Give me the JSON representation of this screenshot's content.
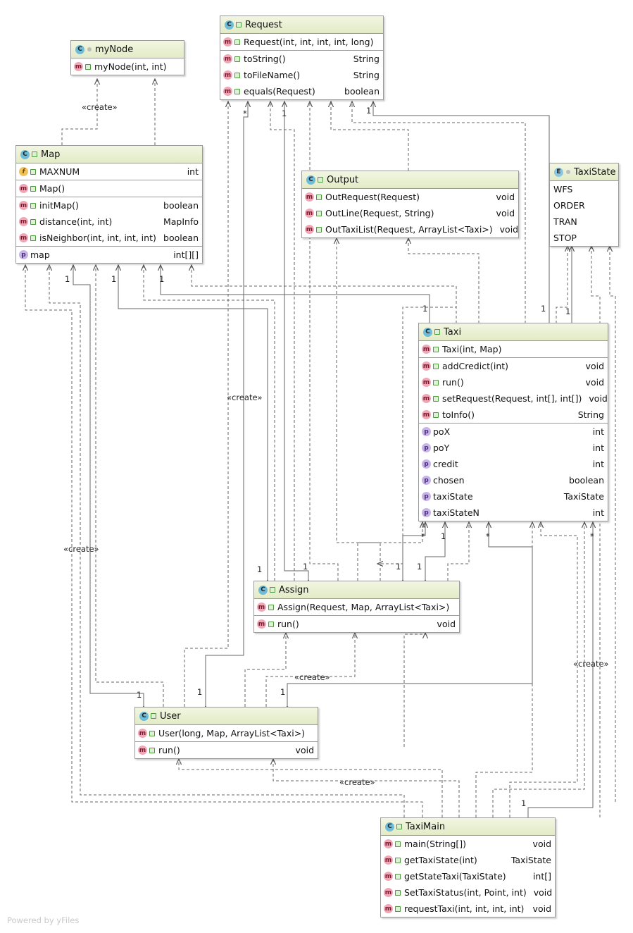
{
  "classes": {
    "mynode": {
      "name": "myNode",
      "methods": [
        {
          "name": "myNode(int, int)",
          "type": ""
        }
      ]
    },
    "request": {
      "name": "Request",
      "methods": [
        {
          "name": "Request(int, int, int, int, long)",
          "type": ""
        },
        {
          "name": "toString()",
          "type": "String"
        },
        {
          "name": "toFileName()",
          "type": "String"
        },
        {
          "name": "equals(Request)",
          "type": "boolean"
        }
      ]
    },
    "map": {
      "name": "Map",
      "fields": [
        {
          "name": "MAXNUM",
          "type": "int"
        }
      ],
      "constructors": [
        {
          "name": "Map()",
          "type": ""
        }
      ],
      "methods": [
        {
          "name": "initMap()",
          "type": "boolean"
        },
        {
          "name": "distance(int, int)",
          "type": "MapInfo"
        },
        {
          "name": "isNeighbor(int, int, int, int)",
          "type": "boolean"
        }
      ],
      "properties": [
        {
          "name": "map",
          "type": "int[][]"
        }
      ]
    },
    "output": {
      "name": "Output",
      "methods": [
        {
          "name": "OutRequest(Request)",
          "type": "void"
        },
        {
          "name": "OutLine(Request, String)",
          "type": "void"
        },
        {
          "name": "OutTaxiList(Request, ArrayList<Taxi>)",
          "type": "void"
        }
      ]
    },
    "taxistate": {
      "name": "TaxiState",
      "values": [
        "WFS",
        "ORDER",
        "TRAN",
        "STOP"
      ]
    },
    "taxi": {
      "name": "Taxi",
      "methods": [
        {
          "name": "Taxi(int, Map)",
          "type": ""
        },
        {
          "name": "addCredict(int)",
          "type": "void"
        },
        {
          "name": "run()",
          "type": "void"
        },
        {
          "name": "setRequest(Request, int[], int[])",
          "type": "void"
        },
        {
          "name": "toInfo()",
          "type": "String"
        }
      ],
      "properties": [
        {
          "name": "poX",
          "type": "int"
        },
        {
          "name": "poY",
          "type": "int"
        },
        {
          "name": "credit",
          "type": "int"
        },
        {
          "name": "chosen",
          "type": "boolean"
        },
        {
          "name": "taxiState",
          "type": "TaxiState"
        },
        {
          "name": "taxiStateN",
          "type": "int"
        }
      ]
    },
    "assign": {
      "name": "Assign",
      "constructors": [
        {
          "name": "Assign(Request, Map, ArrayList<Taxi>)",
          "type": ""
        }
      ],
      "methods": [
        {
          "name": "run()",
          "type": "void"
        }
      ]
    },
    "user": {
      "name": "User",
      "constructors": [
        {
          "name": "User(long, Map, ArrayList<Taxi>)",
          "type": ""
        }
      ],
      "methods": [
        {
          "name": "run()",
          "type": "void"
        }
      ]
    },
    "taximain": {
      "name": "TaxiMain",
      "methods": [
        {
          "name": "main(String[])",
          "type": "void"
        },
        {
          "name": "getTaxiState(int)",
          "type": "TaxiState"
        },
        {
          "name": "getStateTaxi(TaxiState)",
          "type": "int[]"
        },
        {
          "name": "SetTaxiStatus(int, Point, int)",
          "type": "void"
        },
        {
          "name": "requestTaxi(int, int, int, int)",
          "type": "void"
        }
      ]
    }
  },
  "icons": {
    "class": "C",
    "enum": "E",
    "method": "m",
    "field": "f",
    "property": "p"
  },
  "labels": {
    "create": "«create»",
    "one": "1",
    "many": "*",
    "powered": "Powered by yFiles"
  }
}
